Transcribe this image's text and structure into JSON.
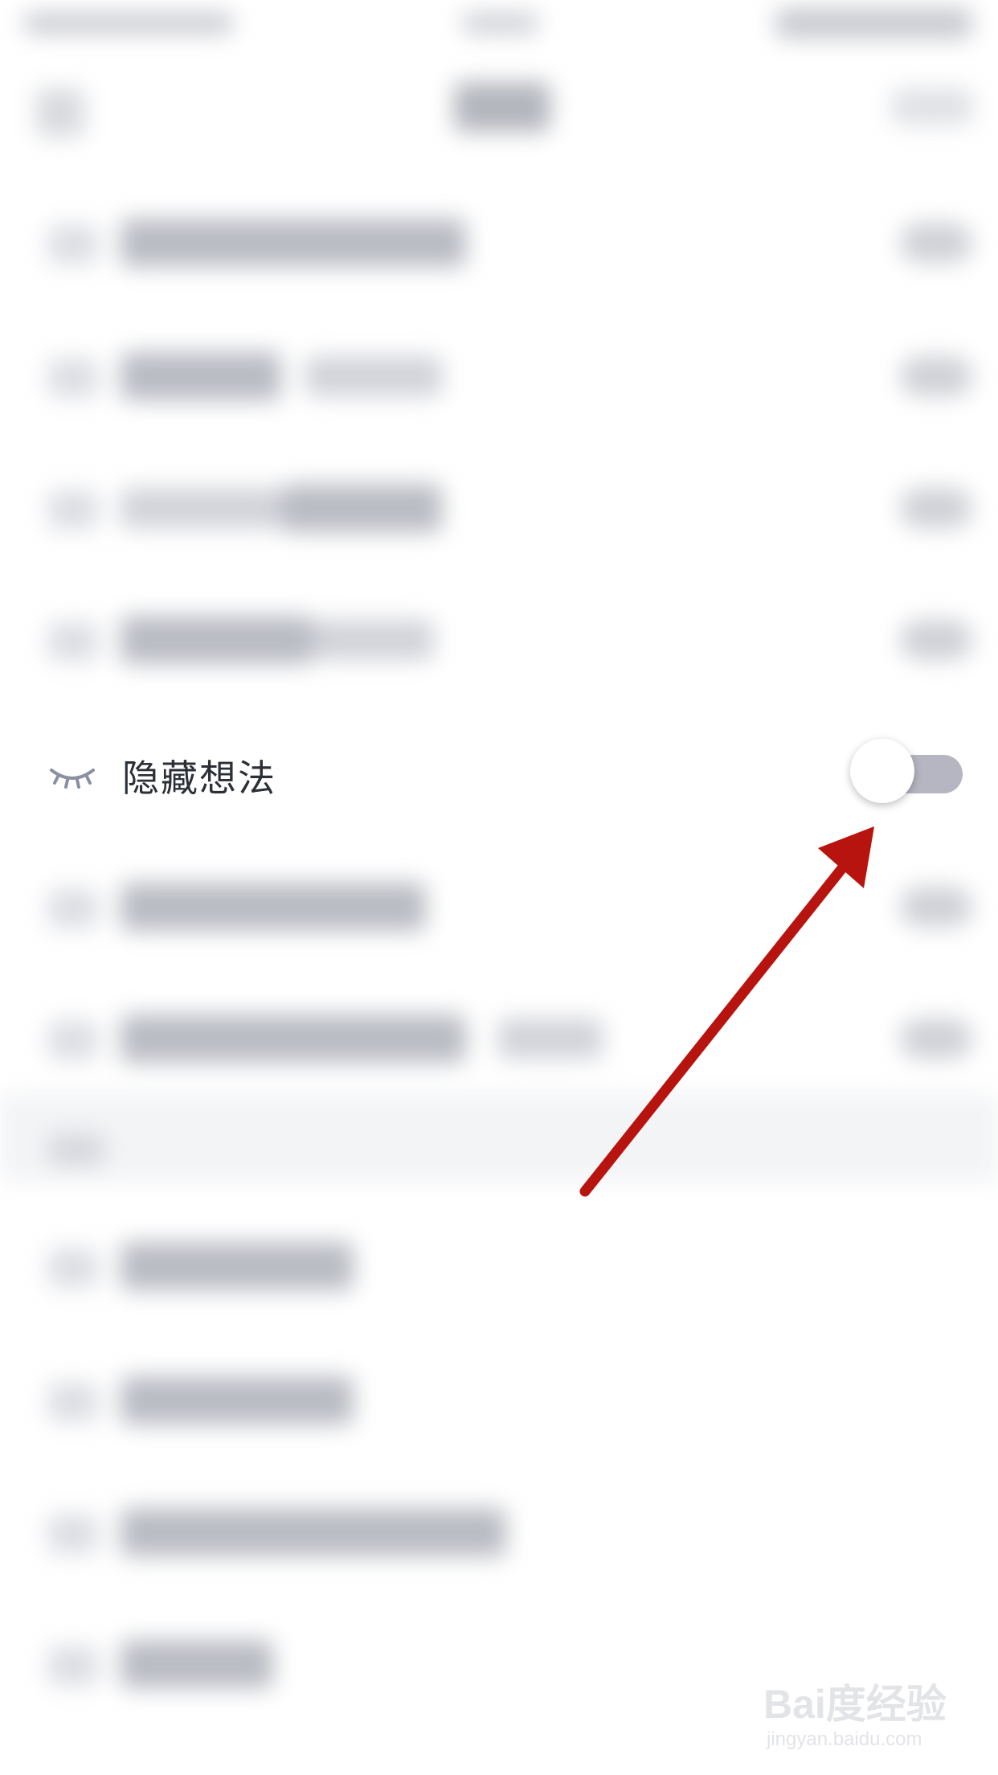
{
  "setting": {
    "label": "隐藏想法",
    "icon": "closed-eye-icon",
    "toggle_state": "off"
  },
  "watermark": {
    "brand": "Bai度经验",
    "url": "jingyan.baidu.com"
  },
  "colors": {
    "arrow": "#b8140f",
    "toggle_track": "#b6b6c3",
    "label_text": "#2b2f36",
    "eye_icon": "#8a8fa3"
  }
}
